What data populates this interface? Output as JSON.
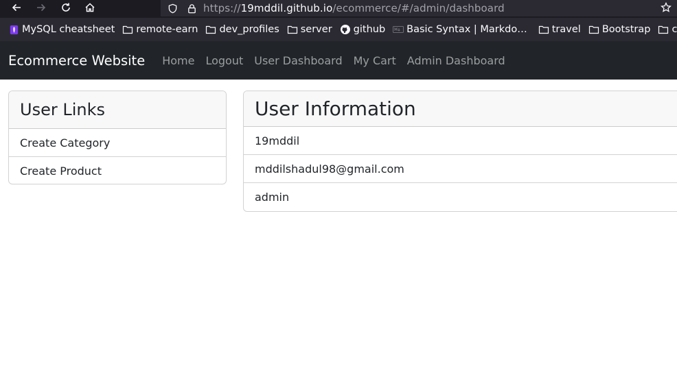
{
  "browser": {
    "url_scheme": "https://",
    "url_host": "19mddil.github.io",
    "url_path": "/ecommerce/#/admin/dashboard",
    "bookmarks": [
      {
        "label": "MySQL cheatsheet",
        "icon": "mysql-bookmark-icon"
      },
      {
        "label": "remote-earn",
        "icon": "folder-icon"
      },
      {
        "label": "dev_profiles",
        "icon": "folder-icon"
      },
      {
        "label": "server",
        "icon": "folder-icon"
      },
      {
        "label": "github",
        "icon": "github-icon"
      },
      {
        "label": "Basic Syntax | Markdo…",
        "icon": "markdown-icon"
      },
      {
        "label": "travel",
        "icon": "folder-icon"
      },
      {
        "label": "Bootstrap",
        "icon": "folder-icon"
      },
      {
        "label": "contest",
        "icon": "folder-icon"
      }
    ]
  },
  "navbar": {
    "brand": "Ecommerce Website",
    "links": [
      "Home",
      "Logout",
      "User Dashboard",
      "My Cart",
      "Admin Dashboard"
    ]
  },
  "user_links": {
    "title": "User Links",
    "items": [
      "Create Category",
      "Create Product"
    ]
  },
  "user_info": {
    "title": "User Information",
    "items": [
      "19mddil",
      "mddilshadul98@gmail.com",
      "admin"
    ]
  }
}
